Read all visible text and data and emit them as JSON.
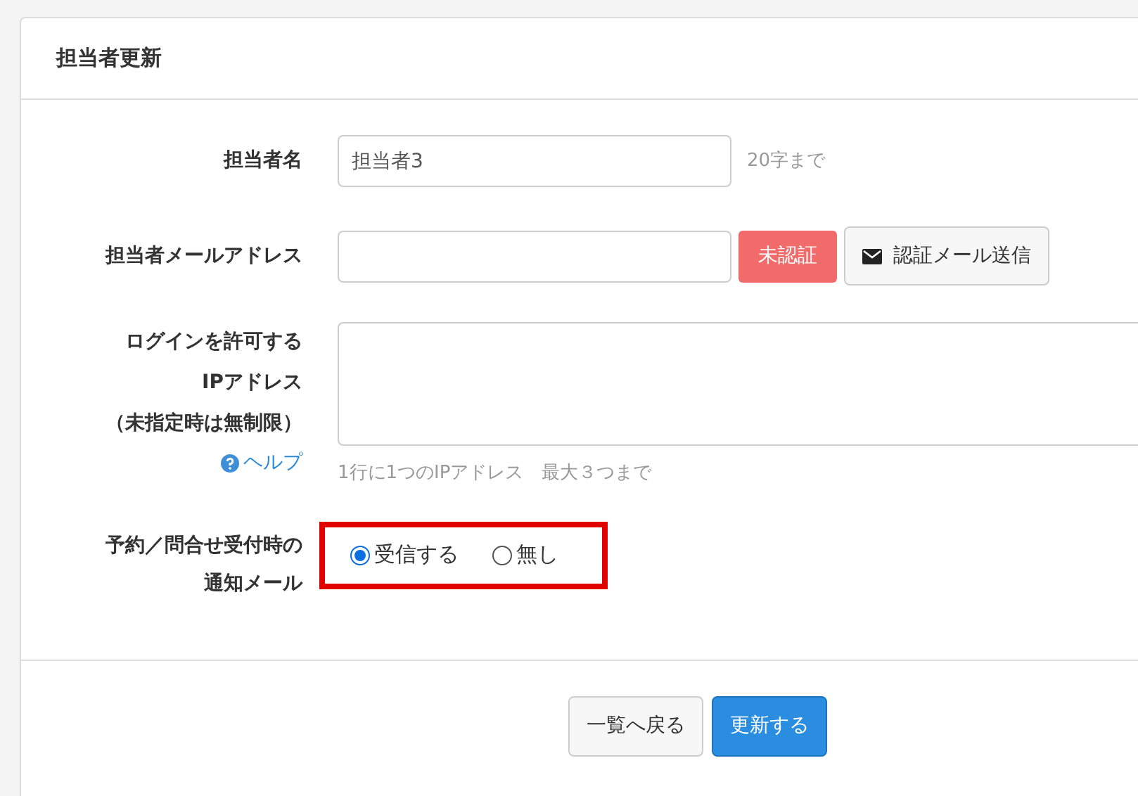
{
  "panel": {
    "title": "担当者更新"
  },
  "name_field": {
    "label": "担当者名",
    "value": "担当者3",
    "hint": "20字まで"
  },
  "email_field": {
    "label": "担当者メールアドレス",
    "value_badge": "未認証",
    "verified": false,
    "send_button": "認証メール送信"
  },
  "ip_field": {
    "label_lines": [
      "ログインを許可する",
      "IPアドレス",
      "（未指定時は無制限）"
    ],
    "help_link": "ヘルプ",
    "hint": "1行に1つのIPアドレス　最大３つまで"
  },
  "notify_field": {
    "label_lines": [
      "予約／問合せ受付時の",
      "通知メール"
    ],
    "highlighted": true,
    "options": [
      {
        "label": "受信する",
        "selected": true
      },
      {
        "label": "無し",
        "selected": false
      }
    ]
  },
  "buttons": [
    {
      "label": "一覧へ戻る",
      "kind": "secondary"
    },
    {
      "label": "更新する",
      "kind": "primary"
    }
  ]
}
